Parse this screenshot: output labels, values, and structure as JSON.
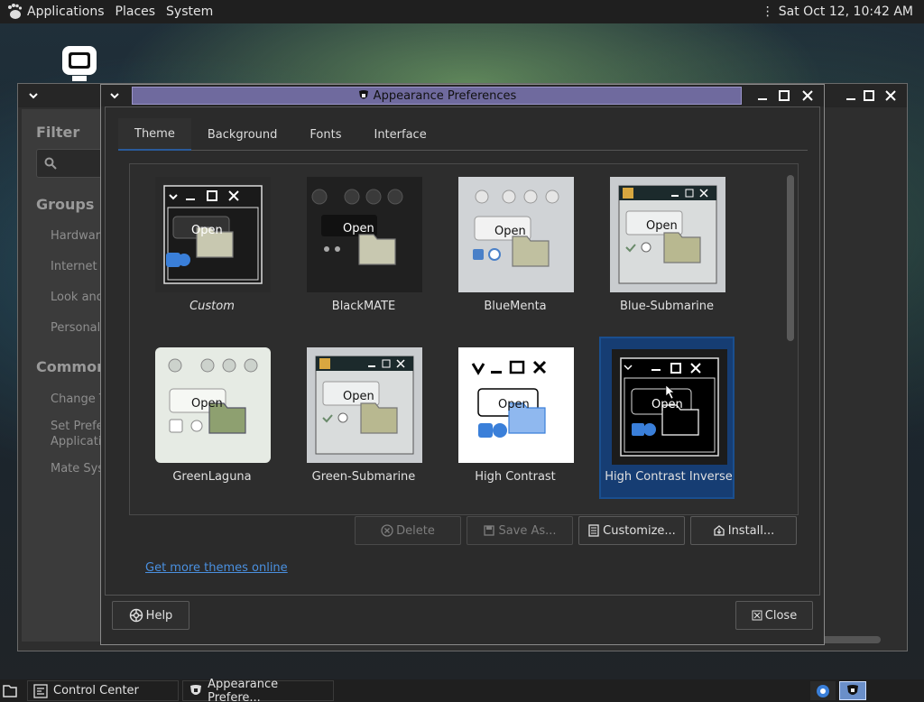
{
  "top_panel": {
    "menu": [
      "Applications",
      "Places",
      "System"
    ],
    "clock": "Sat Oct 12, 10:42 AM"
  },
  "control_center": {
    "filter_title": "Filter",
    "groups_title": "Groups",
    "groups": [
      "Hardware",
      "Internet a",
      "Look and",
      "Personal"
    ],
    "common_title": "Common T",
    "common": [
      "Change T",
      "Set Prefe",
      "Applicati",
      "Mate Syst"
    ]
  },
  "dialog": {
    "title": "Appearance Preferences",
    "tabs": [
      "Theme",
      "Background",
      "Fonts",
      "Interface"
    ],
    "active_tab": "Theme",
    "themes": [
      {
        "name": "Custom",
        "style": "custom"
      },
      {
        "name": "BlackMATE",
        "style": "blackmate"
      },
      {
        "name": "BlueMenta",
        "style": "bluementa"
      },
      {
        "name": "Blue-Submarine",
        "style": "submarine"
      },
      {
        "name": "GreenLaguna",
        "style": "greenlaguna"
      },
      {
        "name": "Green-Submarine",
        "style": "submarine"
      },
      {
        "name": "High Contrast",
        "style": "hc"
      },
      {
        "name": "High Contrast Inverse",
        "style": "hci"
      }
    ],
    "selected_theme": "High Contrast Inverse",
    "thumb_open_label": "Open",
    "buttons": {
      "delete": "Delete",
      "save_as": "Save As...",
      "customize": "Customize...",
      "install": "Install..."
    },
    "more_themes_link": "Get more themes online",
    "help_label": "Help",
    "close_label": "Close"
  },
  "bottom_panel": {
    "tasks": [
      "Control Center",
      "Appearance Prefere..."
    ]
  },
  "colors": {
    "selection": "#163d73",
    "link": "#4a90e0",
    "title_bar": "#6f6a9e"
  }
}
